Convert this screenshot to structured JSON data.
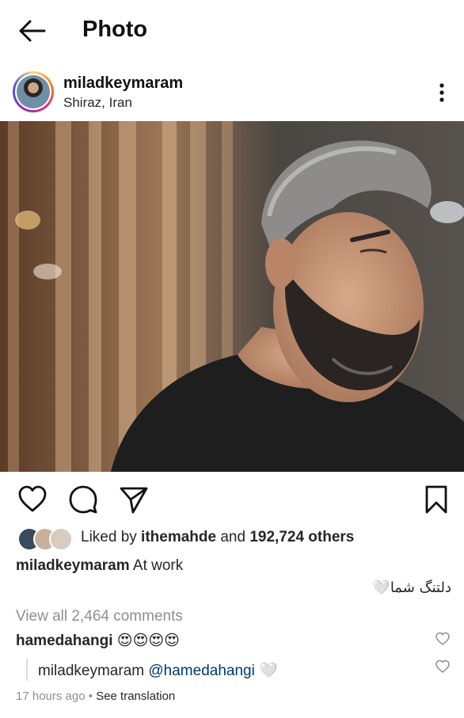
{
  "header": {
    "title": "Photo"
  },
  "post": {
    "username": "miladkeymaram",
    "location": "Shiraz, Iran"
  },
  "likes": {
    "prefix": "Liked by ",
    "user": "ithemahde",
    "middle": " and ",
    "count": "192,724 others"
  },
  "caption": {
    "username": "miladkeymaram",
    "text": "At work",
    "rtl_text": "دلتنگ شما🤍"
  },
  "comments": {
    "view_all": "View all 2,464 comments",
    "items": [
      {
        "username": "hamedahangi",
        "text": "😍😍😍😍"
      }
    ],
    "reply": {
      "username": "miladkeymaram",
      "mention": "@hamedahangi",
      "text": "🤍"
    },
    "time": "17 hours ago",
    "separator": "•",
    "see_translation": "See translation"
  },
  "icons": {
    "back": "arrow-left-icon",
    "more": "more-vertical-icon",
    "like": "heart-icon",
    "comment": "comment-icon",
    "share": "send-icon",
    "save": "bookmark-icon"
  }
}
